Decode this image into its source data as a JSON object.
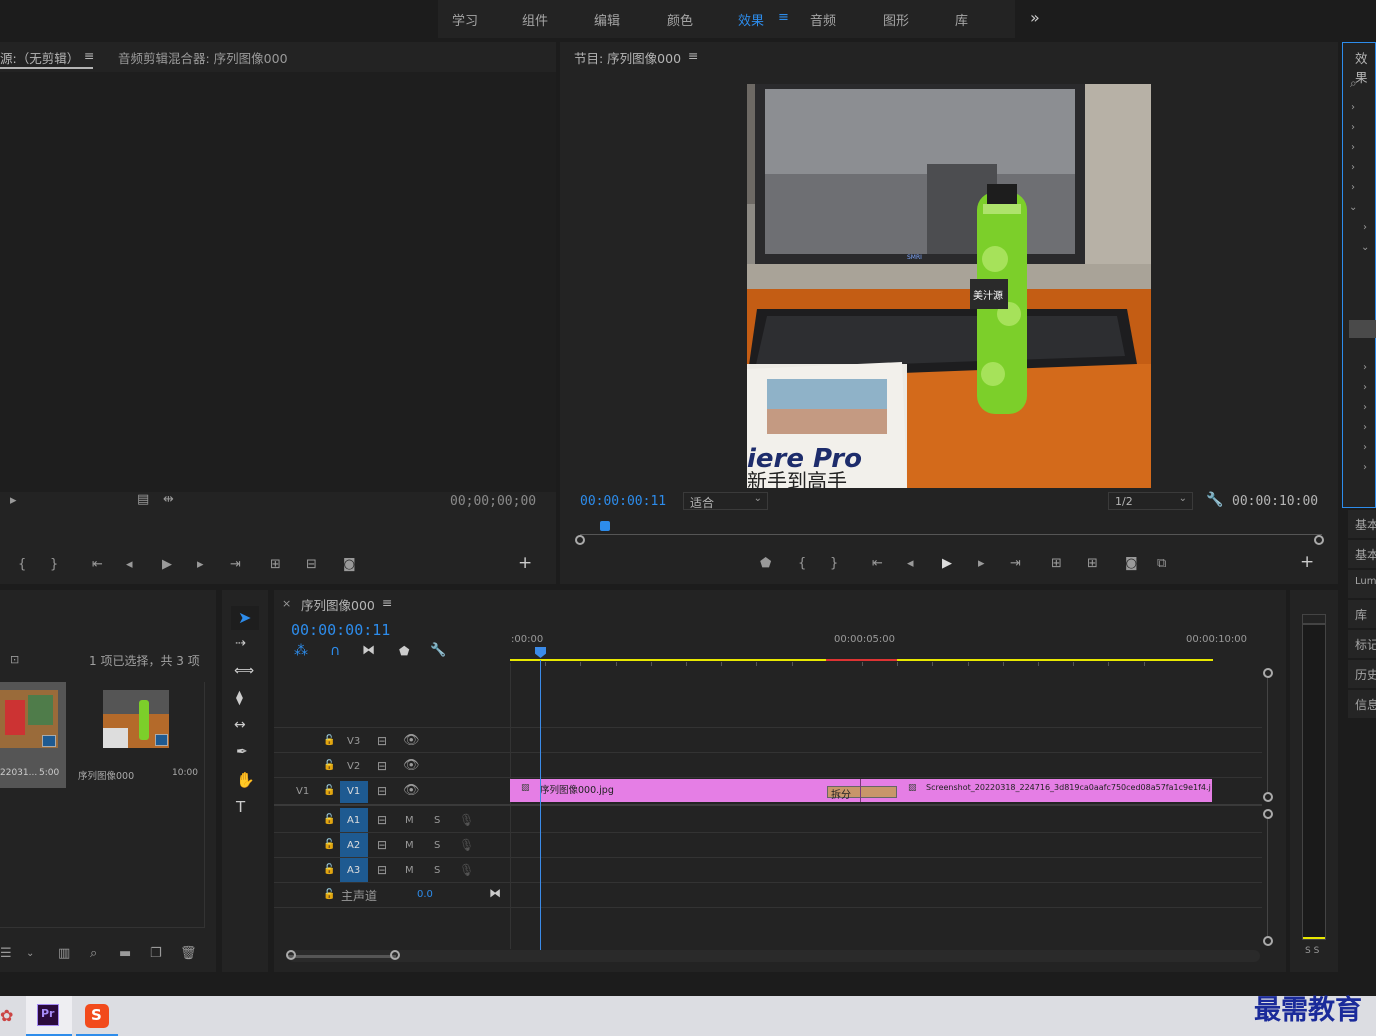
{
  "topbar": {
    "workspaces": [
      "学习",
      "组件",
      "编辑",
      "颜色",
      "效果",
      "音频",
      "图形",
      "库"
    ],
    "active": "效果",
    "active_menu": "≡",
    "more": "»"
  },
  "source_panel": {
    "tab_source": "源:（无剪辑）",
    "tab_source_menu": "≡",
    "tab_mixer": "音频剪辑混合器: 序列图像000",
    "timecode": "00;00;00;00"
  },
  "program": {
    "title": "节目: 序列图像000",
    "menu": "≡",
    "timecode": "00:00:00:11",
    "fit": "适合",
    "quality": "1/2",
    "duration": "00:00:10:00",
    "frame": {
      "monitor_label": "SMRI",
      "bottle_brand": "美汁源",
      "book_text1": "iere Pro",
      "book_text2": "新手到高手"
    }
  },
  "project": {
    "selection": "1 项已选择，共 3 项",
    "items": [
      {
        "name": "22031...",
        "dur": "5:00"
      },
      {
        "name": "序列图像000",
        "dur": "10:00"
      }
    ]
  },
  "timeline": {
    "close": "×",
    "title": "序列图像000",
    "menu": "≡",
    "timecode": "00:00:00:11",
    "ruler": [
      ":00:00",
      "00:00:05:00",
      "00:00:10:00"
    ],
    "tracks_video": [
      "V3",
      "V2",
      "V1"
    ],
    "source_patch": "V1",
    "tracks_audio": [
      "A1",
      "A2",
      "A3"
    ],
    "m_label": "M",
    "s_label": "S",
    "master_label": "主声道",
    "master_value": "0.0",
    "clip1": "序列图像000.jpg",
    "split_label": "拆分",
    "clip2": "Screenshot_20220318_224716_3d819ca0aafc750ced08a57fa1c9e1f4.j"
  },
  "meter": {
    "labels": "S S"
  },
  "right_panel": {
    "title": "效果",
    "items": [
      "基本",
      "基本",
      "Lum",
      "库",
      "标记",
      "历史",
      "信息"
    ]
  },
  "taskbar": {
    "app_pr": "Pr",
    "app_s": "S"
  },
  "watermark": "最需教育",
  "colors": {
    "accent": "#2d8ceb",
    "clip": "#e57ee5",
    "audio_track": "#1e5a91",
    "playhead": "#3b8be8",
    "workarea": "#e8e800"
  }
}
